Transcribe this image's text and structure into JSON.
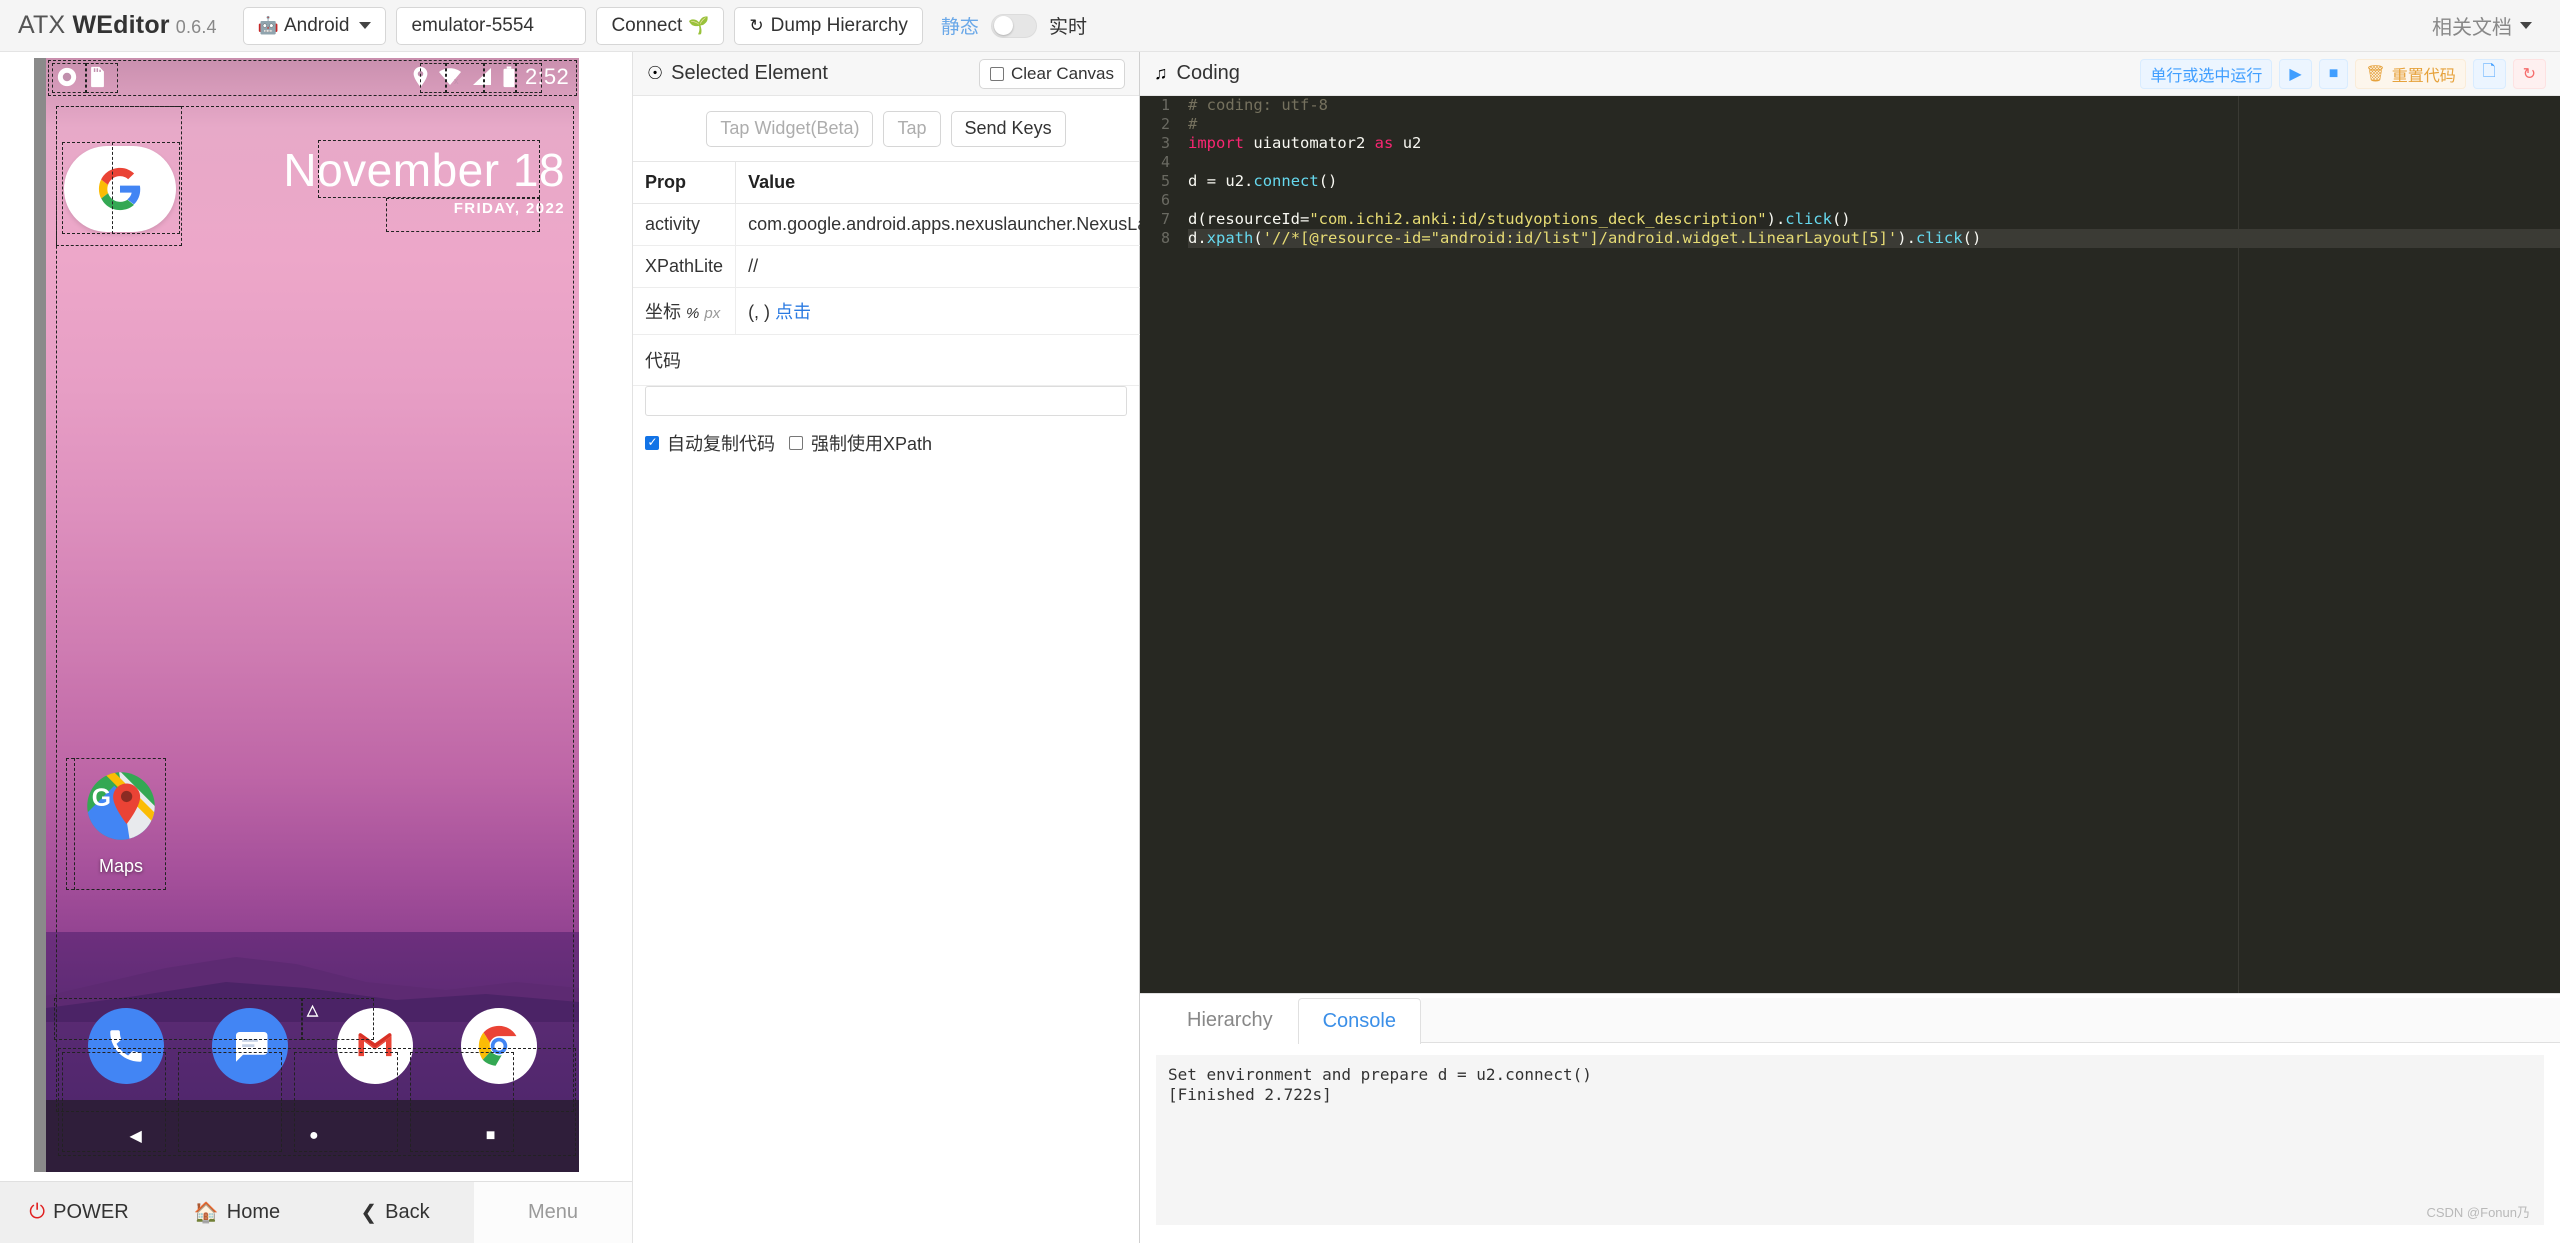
{
  "navbar": {
    "brand_prefix": "ATX ",
    "brand_main": "WEditor",
    "version": "0.6.4",
    "platform_select": "Android",
    "platform_icon": "android-icon",
    "serial_value": "emulator-5554",
    "serial_placeholder": "emulator-5554",
    "connect_label": "Connect",
    "connect_icon": "seedling-icon",
    "dump_label": "Dump Hierarchy",
    "dump_icon": "refresh-icon",
    "toggle_left_label": "静态",
    "toggle_right_label": "实时",
    "toggle_state": "off",
    "docs_label": "相关文档"
  },
  "device": {
    "statusbar": {
      "time": "2:52",
      "icons": [
        "location-icon",
        "wifi-off-icon",
        "signal-icon",
        "battery-icon"
      ]
    },
    "search_widget_icon": "google-g-icon",
    "date_month_day": "November 18",
    "date_sub": "FRIDAY, 2022",
    "app_icons": [
      {
        "name": "google-maps-icon",
        "label": "Maps"
      }
    ],
    "app_drawer_chevron": "chevron-up-icon",
    "dock": [
      {
        "name": "phone-icon",
        "label": "Phone"
      },
      {
        "name": "messages-icon",
        "label": "Messages"
      },
      {
        "name": "gmail-icon",
        "label": "Gmail"
      },
      {
        "name": "chrome-icon",
        "label": "Chrome"
      }
    ],
    "navigation": [
      {
        "name": "back-triangle-icon"
      },
      {
        "name": "home-circle-icon"
      },
      {
        "name": "recents-square-icon"
      }
    ],
    "toolbar": [
      {
        "name": "power",
        "label": "POWER",
        "icon": "power-icon"
      },
      {
        "name": "home",
        "label": "Home",
        "icon": "home-icon"
      },
      {
        "name": "back",
        "label": "Back",
        "icon": "chevron-left-icon"
      },
      {
        "name": "menu",
        "label": "Menu",
        "icon": ""
      }
    ]
  },
  "inspector": {
    "title": "Selected Element",
    "title_icon": "crosshair-icon",
    "clear_canvas_label": "Clear Canvas",
    "clear_canvas_checked": false,
    "buttons": [
      {
        "label": "Tap Widget(Beta)",
        "disabled": true
      },
      {
        "label": "Tap",
        "disabled": true
      },
      {
        "label": "Send Keys",
        "disabled": false
      }
    ],
    "table": {
      "headers": [
        "Prop",
        "Value"
      ],
      "rows": [
        {
          "prop": "activity",
          "value": "com.google.android.apps.nexuslauncher.NexusLauncherActivity"
        },
        {
          "prop": "XPathLite",
          "value": "//"
        }
      ],
      "coord_label": "坐标",
      "coord_unit_pct": "%",
      "coord_unit_px": "px",
      "coord_value": "(, )",
      "coord_action": "点击"
    },
    "code_label": "代码",
    "code_value": "",
    "checkbox_auto_copy": {
      "label": "自动复制代码",
      "checked": true
    },
    "checkbox_force_xpath": {
      "label": "强制使用XPath",
      "checked": false
    }
  },
  "coding": {
    "title": "Coding",
    "title_icon": "music-note-icon",
    "buttons": [
      {
        "name": "run-selection",
        "label": "单行或选中运行",
        "icon": "",
        "style": "blue"
      },
      {
        "name": "run",
        "label": "",
        "icon": "play-icon",
        "style": "blue"
      },
      {
        "name": "stop",
        "label": "",
        "icon": "stop-icon",
        "style": "blue"
      },
      {
        "name": "reset-code",
        "label": "重置代码",
        "icon": "trash-icon",
        "style": "orange"
      },
      {
        "name": "copy-code",
        "label": "",
        "icon": "copy-icon",
        "style": "blue"
      },
      {
        "name": "refresh",
        "label": "",
        "icon": "refresh-icon",
        "style": "red"
      }
    ],
    "editor": {
      "lines": [
        {
          "n": 1,
          "text": "# coding: utf-8",
          "type": "comment"
        },
        {
          "n": 2,
          "text": "#",
          "type": "comment"
        },
        {
          "n": 3,
          "text": "import uiautomator2 as u2",
          "type": "import"
        },
        {
          "n": 4,
          "text": "",
          "type": "blank"
        },
        {
          "n": 5,
          "text": "d = u2.connect()",
          "type": "code"
        },
        {
          "n": 6,
          "text": "",
          "type": "blank"
        },
        {
          "n": 7,
          "text": "d(resourceId=\"com.ichi2.anki:id/studyoptions_deck_description\").click()",
          "type": "code"
        },
        {
          "n": 8,
          "text": "d.xpath('//*[@resource-id=\"android:id/list\"]/android.widget.LinearLayout[5]').click()",
          "type": "code"
        }
      ],
      "cursor_line": 8
    },
    "tabs": [
      {
        "label": "Hierarchy",
        "active": false
      },
      {
        "label": "Console",
        "active": true
      }
    ],
    "console_lines": [
      "Set environment and prepare d = u2.connect()",
      "[Finished 2.722s]"
    ],
    "watermark": "CSDN @Fonun乃"
  },
  "colors": {
    "accent_blue": "#409eff",
    "orange": "#e6a23c",
    "red": "#f56c6c",
    "editor_bg": "#272822"
  }
}
